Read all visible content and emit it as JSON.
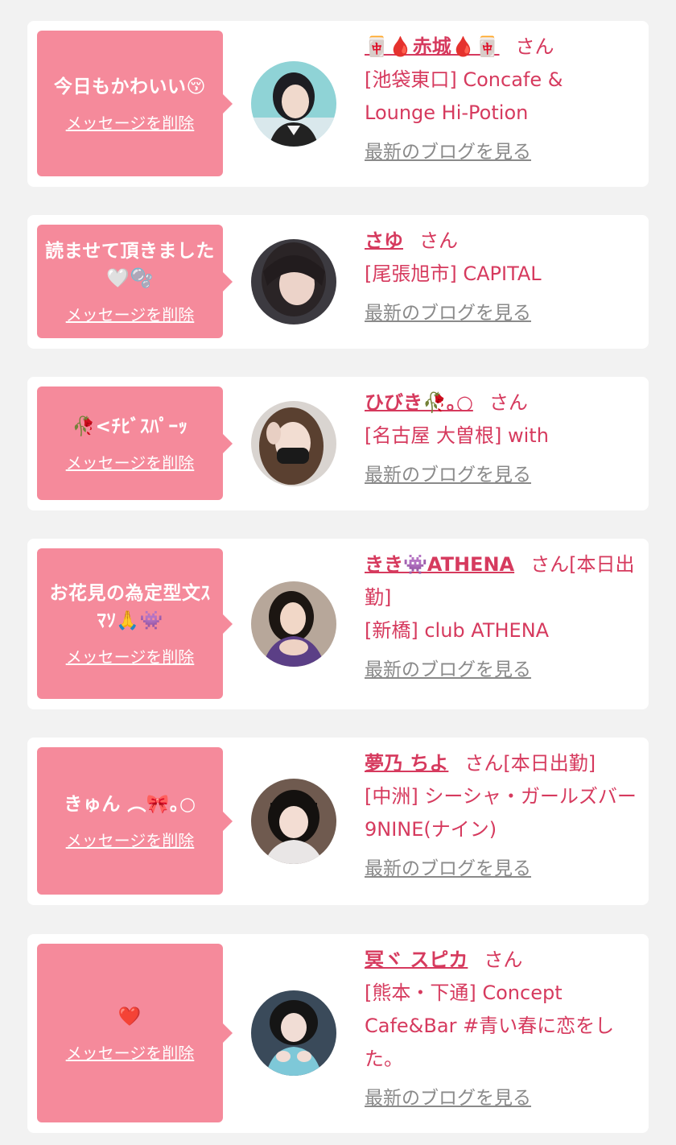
{
  "colors": {
    "background": "#f2f2f2",
    "card": "#ffffff",
    "bubble": "#f58a9b",
    "accent_text": "#d63a5e",
    "muted_link": "#8a8a8a"
  },
  "cards": [
    {
      "message": "今日もかわいい😚",
      "delete_label": "メッセージを削除",
      "name": "🀄🩸赤城🩸🀄",
      "honorific": "さん",
      "shop": "[池袋東口] Concafe & Lounge Hi-Potion",
      "blog_label": "最新のブログを見る"
    },
    {
      "message": "読ませて頂きました🤍🫧",
      "delete_label": "メッセージを削除",
      "name": "さゆ",
      "honorific": "さん",
      "shop": "[尾張旭市] CAPITAL",
      "blog_label": "最新のブログを見る"
    },
    {
      "message": "🥀<ﾁﾋﾞｽﾊﾟｰｯ",
      "delete_label": "メッセージを削除",
      "name": "ひびき🥀｡○",
      "honorific": "さん",
      "shop": "[名古屋 大曽根] with",
      "blog_label": "最新のブログを見る"
    },
    {
      "message": "お花見の為定型文ｽﾏｿ🙏👾",
      "delete_label": "メッセージを削除",
      "name": "きき👾ATHENA",
      "honorific": "さん[本日出勤]",
      "shop": "[新橋] club ATHENA",
      "blog_label": "最新のブログを見る"
    },
    {
      "message": "きゅん ︵🎀｡○",
      "delete_label": "メッセージを削除",
      "name": "夢乃 ちよ",
      "honorific": "さん[本日出勤]",
      "shop": "[中洲] シーシャ・ガールズバー 9NINE(ナイン)",
      "blog_label": "最新のブログを見る"
    },
    {
      "message": "❤️",
      "delete_label": "メッセージを削除",
      "name": "冥ヾ スピカ",
      "honorific": "さん",
      "shop": "[熊本・下通] Concept Cafe&Bar #青い春に恋をした。",
      "blog_label": "最新のブログを見る"
    }
  ]
}
